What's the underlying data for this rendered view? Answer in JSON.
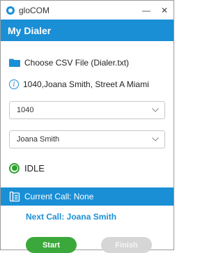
{
  "window": {
    "app_title": "gloCOM",
    "minimize": "—",
    "close": "✕"
  },
  "header": {
    "title": "My Dialer"
  },
  "csv": {
    "label": "Choose CSV File (Dialer.txt)",
    "icon": "folder-icon"
  },
  "contact": {
    "info": "1040,Joana Smith, Street A Miami",
    "icon": "info-icon"
  },
  "selects": {
    "extension": "1040",
    "name": "Joana Smith"
  },
  "status": {
    "text": "IDLE",
    "color": "#2ea02e"
  },
  "current_call": {
    "label": "Current Call: None",
    "icon": "phone-book-icon"
  },
  "next_call": {
    "label": "Next Call: Joana Smith"
  },
  "buttons": {
    "start": "Start",
    "finish": "Finish"
  },
  "colors": {
    "accent": "#1a8fd6",
    "start": "#3aa83a",
    "disabled": "#d6d6d6"
  }
}
